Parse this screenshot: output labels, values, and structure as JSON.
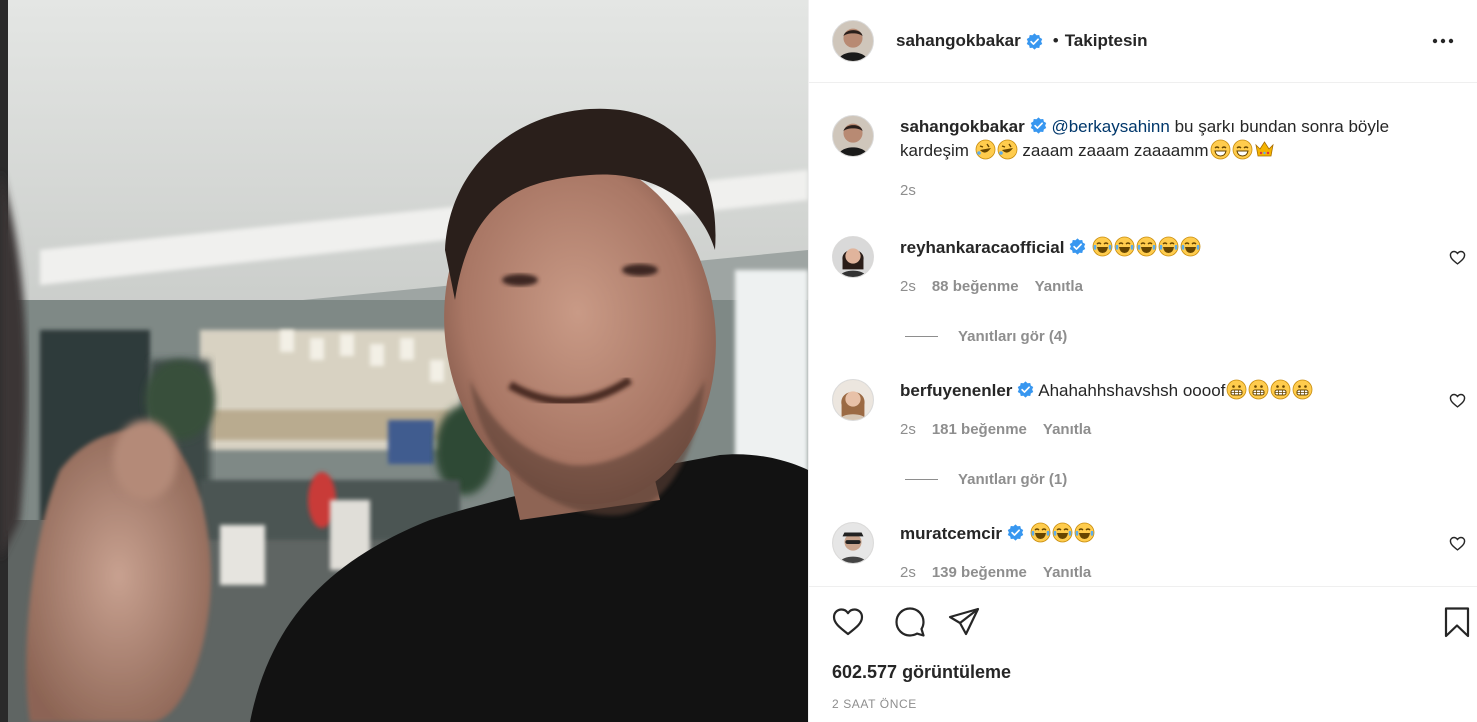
{
  "post": {
    "author": "sahangokbakar",
    "follow_state": "Takiptesin",
    "separator": "•",
    "caption": {
      "mention": "@berkaysahinn",
      "text_part1": " bu şarkı bundan sonra böyle kardeşim ",
      "text_part2": " zaaam zaaam zaaaamm",
      "time": "2s"
    },
    "views": "602.577 görüntüleme",
    "time_ago": "2 SAAT ÖNCE"
  },
  "comments": [
    {
      "username": "reyhankaracaofficial",
      "emoji_count": 5,
      "time": "2s",
      "likes": "88 beğenme",
      "reply_label": "Yanıtla",
      "view_replies": "Yanıtları gör (4)"
    },
    {
      "username": "berfuyenenler",
      "text": "Ahahahhshavshsh oooof",
      "emoji_count": 4,
      "time": "2s",
      "likes": "181 beğenme",
      "reply_label": "Yanıtla",
      "view_replies": "Yanıtları gör (1)"
    },
    {
      "username": "muratcemcir",
      "emoji_count": 3,
      "time": "2s",
      "likes": "139 beğenme",
      "reply_label": "Yanıtla"
    }
  ],
  "icons": {
    "verified": "verified-badge-icon",
    "more": "more-options-icon",
    "like": "heart-icon",
    "comment": "comment-icon",
    "share": "share-icon",
    "save": "bookmark-icon"
  },
  "colors": {
    "verified_blue": "#3897f0",
    "mention": "#00376b",
    "muted": "#8e8e8e",
    "text": "#262626"
  }
}
